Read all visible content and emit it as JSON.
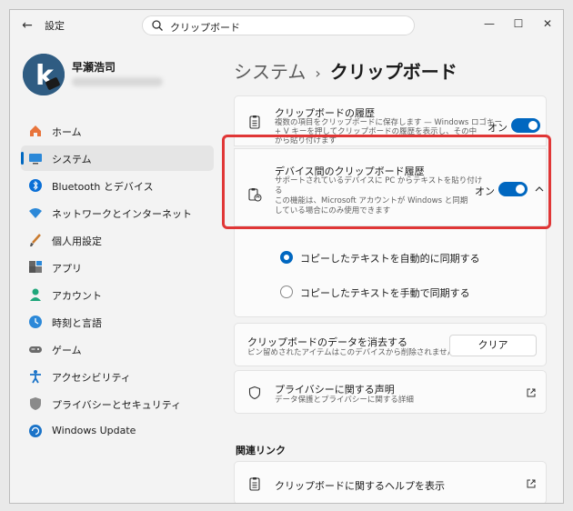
{
  "titlebar": {
    "back_glyph": "←",
    "title": "設定",
    "search_value": "クリップボード",
    "min_glyph": "—",
    "max_glyph": "☐",
    "close_glyph": "✕"
  },
  "profile": {
    "name": "早瀬浩司"
  },
  "sidebar": {
    "items": [
      {
        "label": "ホーム",
        "icon": "home-icon"
      },
      {
        "label": "システム",
        "icon": "system-icon"
      },
      {
        "label": "Bluetooth とデバイス",
        "icon": "bluetooth-icon"
      },
      {
        "label": "ネットワークとインターネット",
        "icon": "wifi-icon"
      },
      {
        "label": "個人用設定",
        "icon": "brush-icon"
      },
      {
        "label": "アプリ",
        "icon": "apps-icon"
      },
      {
        "label": "アカウント",
        "icon": "account-icon"
      },
      {
        "label": "時刻と言語",
        "icon": "clock-icon"
      },
      {
        "label": "ゲーム",
        "icon": "gamepad-icon"
      },
      {
        "label": "アクセシビリティ",
        "icon": "accessibility-icon"
      },
      {
        "label": "プライバシーとセキュリティ",
        "icon": "shield-icon"
      },
      {
        "label": "Windows Update",
        "icon": "update-icon"
      }
    ]
  },
  "breadcrumb": {
    "parent": "システム",
    "sep": "›",
    "current": "クリップボード"
  },
  "history": {
    "title": "クリップボードの履歴",
    "desc1": "複数の項目をクリップボードに保存します — Windows ロゴキー",
    "desc2": "+ V キーを押してクリップボードの履歴を表示し、その中",
    "desc3": "から貼り付けます",
    "state": "オン"
  },
  "sync": {
    "title": "デバイス間のクリップボード履歴",
    "desc1": "サポートされているデバイスに PC からテキストを貼り付け",
    "desc2": "る",
    "desc3": "この機能は、Microsoft アカウントが Windows と同期",
    "desc4": "している場合にのみ使用できます",
    "state": "オン"
  },
  "sync_options": {
    "auto": "コピーしたテキストを自動的に同期する",
    "manual": "コピーしたテキストを手動で同期する"
  },
  "clear": {
    "title": "クリップボードのデータを消去する",
    "desc": "ピン留めされたアイテムはこのデバイスから削除されません",
    "button": "クリア"
  },
  "privacy": {
    "title": "プライバシーに関する声明",
    "desc": "データ保護とプライバシーに関する詳細"
  },
  "related": {
    "title": "関連リンク",
    "help": "クリップボードに関するヘルプを表示"
  },
  "colors": {
    "accent": "#0067c0",
    "highlight": "#e03636"
  }
}
